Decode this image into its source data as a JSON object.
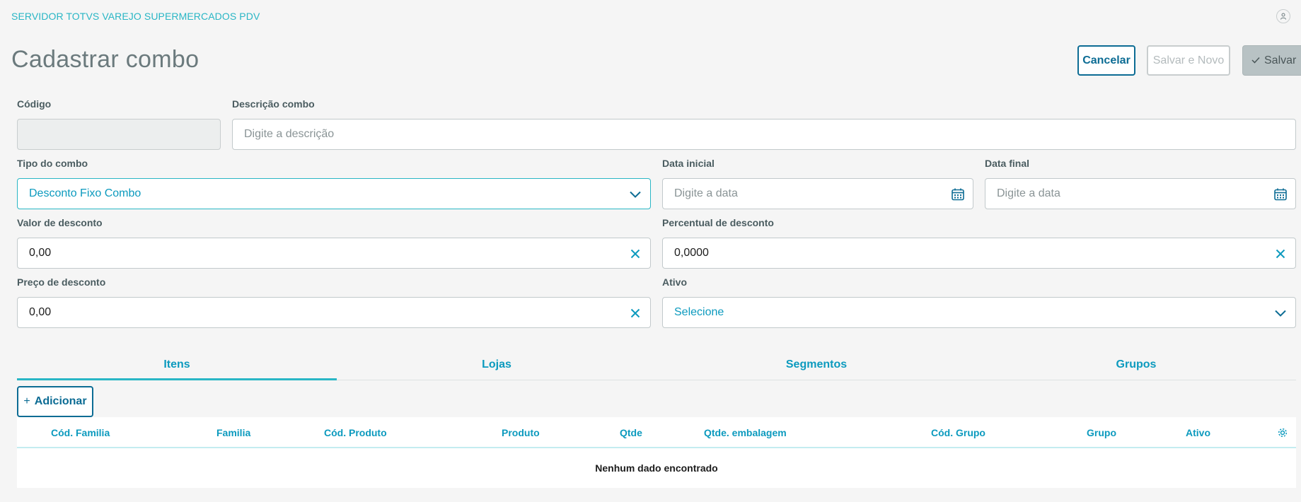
{
  "header": {
    "app_title": "SERVIDOR TOTVS VAREJO SUPERMERCADOS PDV",
    "user_icon": "user-icon"
  },
  "page": {
    "title": "Cadastrar combo"
  },
  "actions": {
    "cancel": "Cancelar",
    "save_and_new": "Salvar e Novo",
    "save": "Salvar"
  },
  "form": {
    "codigo": {
      "label": "Código",
      "value": ""
    },
    "descricao": {
      "label": "Descrição combo",
      "placeholder": "Digite a descrição"
    },
    "tipo": {
      "label": "Tipo do combo",
      "value": "Desconto Fixo Combo"
    },
    "data_inicial": {
      "label": "Data inicial",
      "placeholder": "Digite a data"
    },
    "data_final": {
      "label": "Data final",
      "placeholder": "Digite a data"
    },
    "valor_desconto": {
      "label": "Valor de desconto",
      "value": "0,00"
    },
    "percentual_desconto": {
      "label": "Percentual de desconto",
      "value": "0,0000"
    },
    "preco_desconto": {
      "label": "Preço de desconto",
      "value": "0,00"
    },
    "ativo": {
      "label": "Ativo",
      "value": "Selecione"
    }
  },
  "tabs": [
    {
      "label": "Itens",
      "active": true
    },
    {
      "label": "Lojas",
      "active": false
    },
    {
      "label": "Segmentos",
      "active": false
    },
    {
      "label": "Grupos",
      "active": false
    }
  ],
  "add_button": "Adicionar",
  "table": {
    "columns": [
      "Cód. Familia",
      "Familia",
      "Cód. Produto",
      "Produto",
      "Qtde",
      "Qtde. embalagem",
      "Cód. Grupo",
      "Grupo",
      "Ativo"
    ],
    "empty_message": "Nenhum dado encontrado"
  },
  "colors": {
    "primary": "#0c6c94",
    "accent": "#29b6c5",
    "link": "#0c9abe"
  }
}
